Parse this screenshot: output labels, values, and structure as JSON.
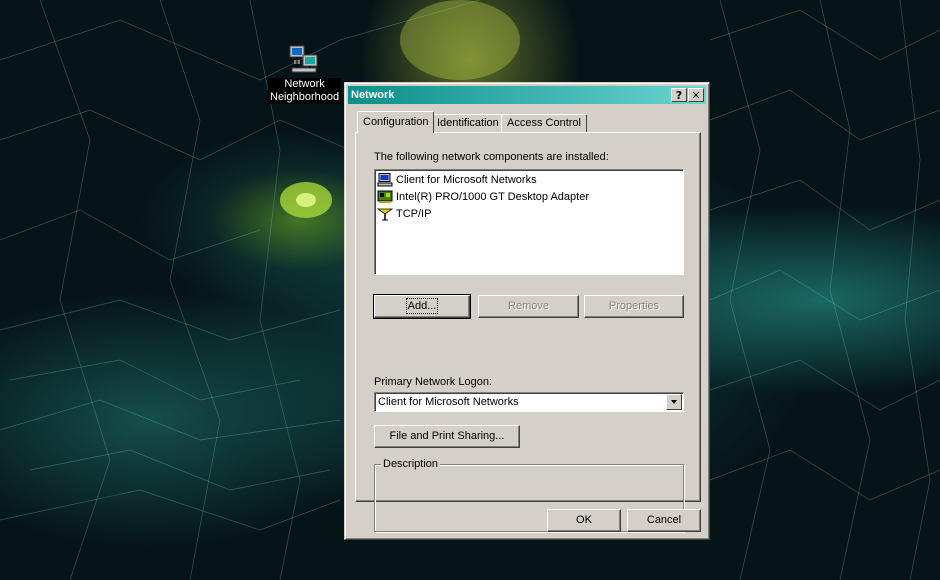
{
  "desktop": {
    "icon_label_line1": "Network",
    "icon_label_line2": "Neighborhood",
    "icon": "network-neighborhood-icon"
  },
  "window": {
    "title": "Network",
    "help_glyph": "?",
    "close_glyph": "✕"
  },
  "tabs": [
    {
      "label": "Configuration",
      "active": true
    },
    {
      "label": "Identification",
      "active": false
    },
    {
      "label": "Access Control",
      "active": false
    }
  ],
  "config": {
    "installed_label": "The following network components are installed:",
    "components": [
      {
        "label": "Client for Microsoft Networks",
        "icon": "client-computer-icon"
      },
      {
        "label": "Intel(R) PRO/1000 GT Desktop Adapter",
        "icon": "network-adapter-icon"
      },
      {
        "label": "TCP/IP",
        "icon": "protocol-icon"
      }
    ],
    "add_button": "Add...",
    "remove_button": "Remove",
    "properties_button": "Properties",
    "primary_logon_label": "Primary Network Logon:",
    "primary_logon_value": "Client for Microsoft Networks",
    "file_print_button": "File and Print Sharing...",
    "description_label": "Description"
  },
  "footer": {
    "ok_button": "OK",
    "cancel_button": "Cancel"
  },
  "colors": {
    "titlebar_start": "#0a8f8a",
    "titlebar_end": "#6ad4d0",
    "dialog_face": "#d4d0c8"
  }
}
